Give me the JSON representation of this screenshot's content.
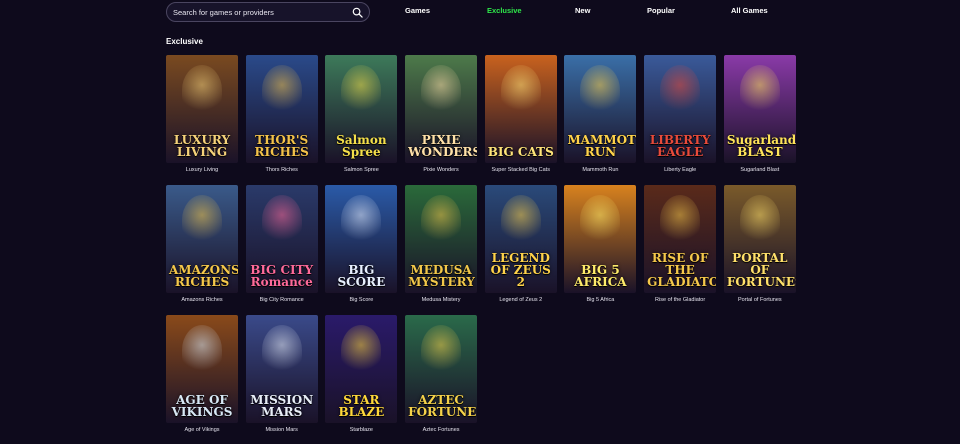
{
  "search": {
    "placeholder": "Search for games or providers",
    "icon": "search-icon"
  },
  "nav": [
    {
      "label": "Games",
      "active": false
    },
    {
      "label": "Exclusive",
      "active": true
    },
    {
      "label": "New",
      "active": false
    },
    {
      "label": "Popular",
      "active": false
    },
    {
      "label": "All Games",
      "active": false
    }
  ],
  "colors": {
    "background": "#0e0a1c",
    "active_tab": "#2ee84a"
  },
  "section": {
    "title": "Exclusive"
  },
  "games": [
    {
      "name": "Luxury Living",
      "logo": "LUXURY LIVING",
      "bg": "#7a4a20",
      "fg": "#f5d27a"
    },
    {
      "name": "Thors Riches",
      "logo": "THOR'S RICHES",
      "bg": "#2a4a8a",
      "fg": "#f3c24a"
    },
    {
      "name": "Salmon Spree",
      "logo": "Salmon Spree",
      "bg": "#3d7a5a",
      "fg": "#f4e04a"
    },
    {
      "name": "Pixie Wonders",
      "logo": "PIXIE WONDERS",
      "bg": "#4d7a4a",
      "fg": "#ffe1a8"
    },
    {
      "name": "Super Stacked Big Cats",
      "logo": "BIG CATS",
      "bg": "#c9621e",
      "fg": "#ffe57a"
    },
    {
      "name": "Mammoth Run",
      "logo": "MAMMOTH RUN",
      "bg": "#3a6fa8",
      "fg": "#ffd34a"
    },
    {
      "name": "Liberty Eagle",
      "logo": "LIBERTY EAGLE",
      "bg": "#3a5a9a",
      "fg": "#e84a3a"
    },
    {
      "name": "Sugarland Blast",
      "logo": "Sugarland BLAST",
      "bg": "#8a3aa8",
      "fg": "#ffe45a"
    },
    {
      "name": "Amazons Riches",
      "logo": "AMAZONS RICHES",
      "bg": "#3a5a8a",
      "fg": "#f5c84a"
    },
    {
      "name": "Big City Romance",
      "logo": "BIG CITY Romance",
      "bg": "#2a3a6a",
      "fg": "#ff6a9a"
    },
    {
      "name": "Big Score",
      "logo": "BIG SCORE",
      "bg": "#2a5aa8",
      "fg": "#e8f0ff"
    },
    {
      "name": "Medusa Mistery",
      "logo": "MEDUSA MYSTERY",
      "bg": "#2a6a3a",
      "fg": "#f2c84a"
    },
    {
      "name": "Legend of Zeus 2",
      "logo": "LEGEND OF ZEUS 2",
      "bg": "#2a4a7a",
      "fg": "#ffd34a"
    },
    {
      "name": "Big 5 Africa",
      "logo": "BIG 5 AFRICA",
      "bg": "#d8821e",
      "fg": "#ffec6a"
    },
    {
      "name": "Rise of the Gladiator",
      "logo": "RISE OF THE GLADIATOR",
      "bg": "#5a2a1a",
      "fg": "#f5c84a"
    },
    {
      "name": "Portal of Fortunes",
      "logo": "PORTAL OF FORTUNES",
      "bg": "#7a5a2a",
      "fg": "#ffe06a"
    },
    {
      "name": "Age of Vikings",
      "logo": "AGE OF VIKINGS",
      "bg": "#8a4a1a",
      "fg": "#d8e8f5"
    },
    {
      "name": "Mission Mars",
      "logo": "MISSION MARS",
      "bg": "#3a4a8a",
      "fg": "#e8eef8"
    },
    {
      "name": "Starblaze",
      "logo": "STAR BLAZE",
      "bg": "#2a1a6a",
      "fg": "#ffd83a"
    },
    {
      "name": "Aztec Fortunes",
      "logo": "AZTEC FORTUNES",
      "bg": "#2a6a4a",
      "fg": "#f5d24a"
    }
  ]
}
